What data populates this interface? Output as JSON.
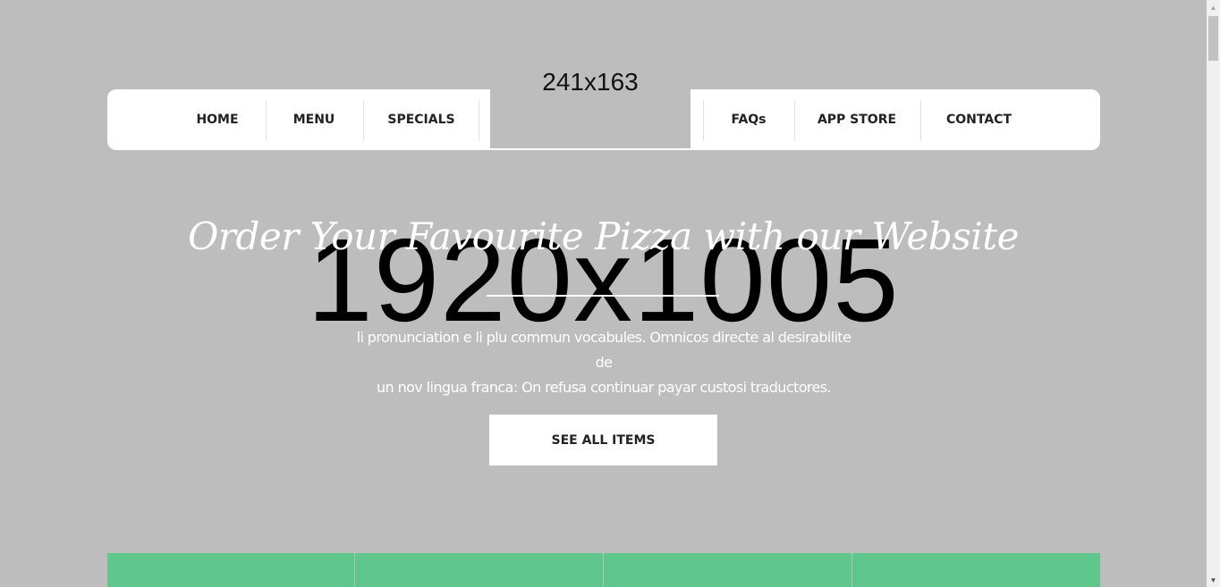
{
  "nav": {
    "left_items": [
      {
        "label": "HOME"
      },
      {
        "label": "MENU"
      },
      {
        "label": "SPECIALS"
      }
    ],
    "logo_text": "241x163",
    "right_items": [
      {
        "label": "FAQs"
      },
      {
        "label": "APP STORE"
      },
      {
        "label": "CONTACT"
      }
    ]
  },
  "hero": {
    "background_placeholder": "1920x1005",
    "title": "Order Your Favourite Pizza with our Website",
    "description_line1": "li pronunciation e li plu commun vocabules. Omnicos directe al desirabilite de",
    "description_line2": "un nov lingua franca: On refusa continuar payar custosi traductores.",
    "cta_label": "SEE ALL ITEMS"
  },
  "colors": {
    "background": "#bdbdbd",
    "nav_background": "#ffffff",
    "tile_green": "#5fc68c"
  },
  "tiles_count": 4
}
